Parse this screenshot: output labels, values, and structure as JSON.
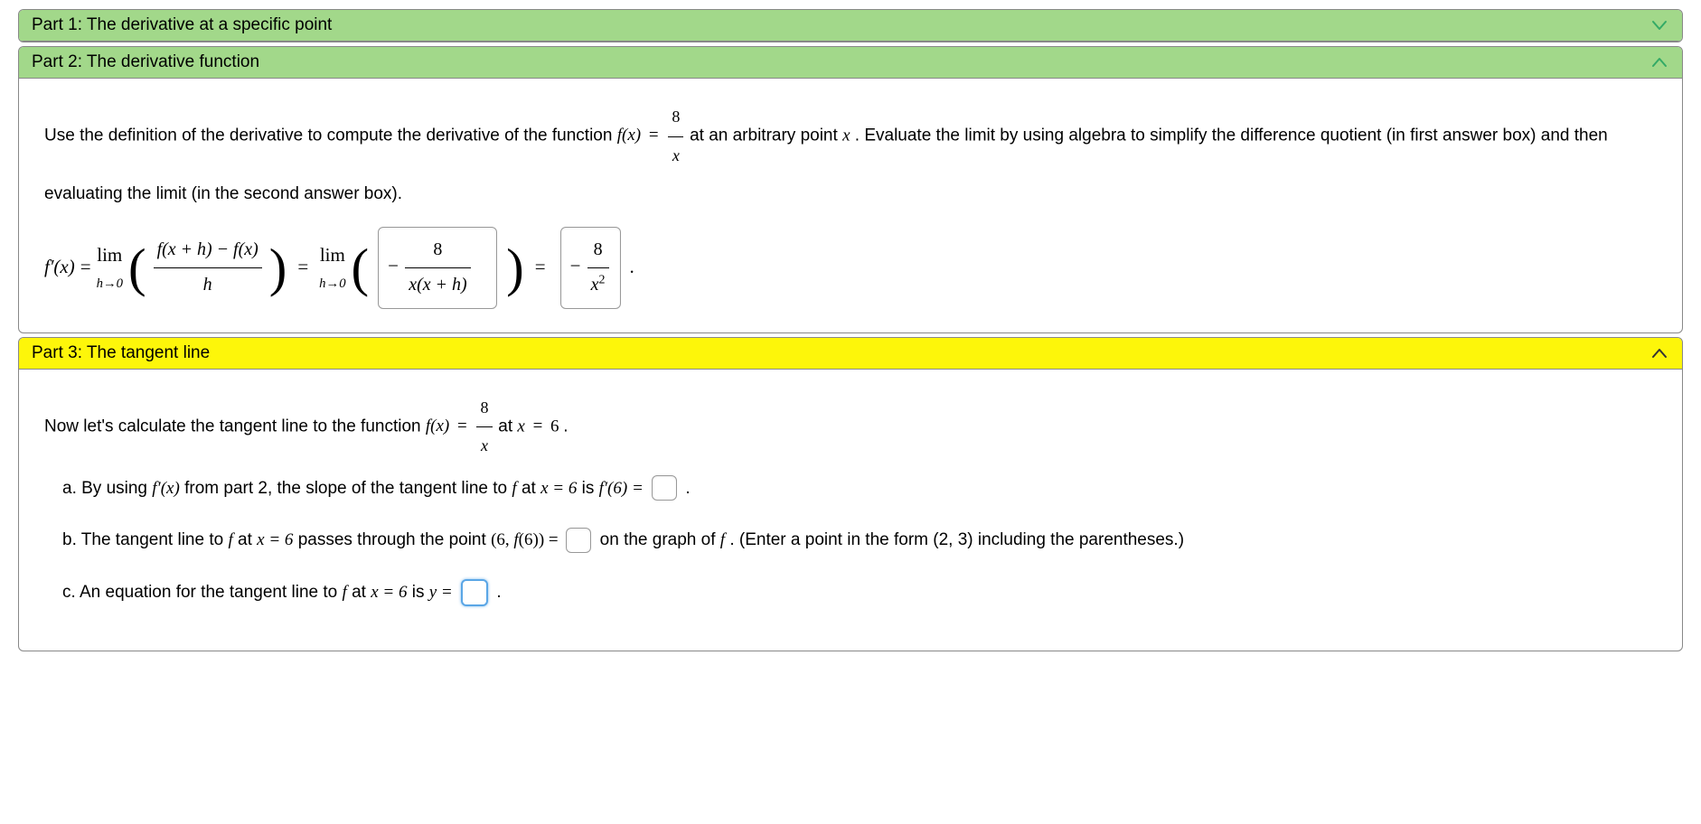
{
  "part1": {
    "title": "Part 1: The derivative at a specific point"
  },
  "part2": {
    "title": "Part 2: The derivative function",
    "intro_a": "Use the definition of the derivative to compute the derivative of the function ",
    "intro_b": " at an arbitrary point ",
    "intro_c": ". Evaluate the limit by using algebra to simplify the difference quotient (in first answer box) and then evaluating the limit (in the second answer box).",
    "func": {
      "lhs": "f(x)",
      "eq": "=",
      "num": "8",
      "den": "x"
    },
    "eq": {
      "lhs": "f′(x)",
      "eq": "=",
      "lim": "lim",
      "limsub": "h→0",
      "dq_num": "f(x + h) − f(x)",
      "dq_den": "h",
      "ans1_prefix": "−",
      "ans1_num": "8",
      "ans1_den": "x(x + h)",
      "ans2_prefix": "−",
      "ans2_num": "8",
      "ans2_den_base": "x",
      "ans2_den_exp": "2"
    }
  },
  "part3": {
    "title": "Part 3: The tangent line",
    "intro_a": "Now let's calculate the tangent line to the function ",
    "intro_b": " at ",
    "intro_c": ".",
    "func": {
      "lhs": "f(x)",
      "eq": "=",
      "num": "8",
      "den": "x"
    },
    "at": {
      "lhs": "x",
      "eq": "=",
      "val": "6"
    },
    "a": {
      "pre": "a. By using ",
      "fp": "f′(x)",
      "mid1": " from part 2, the slope of the tangent line to ",
      "f": "f",
      "mid2": " at ",
      "xeq": "x = 6",
      "mid3": " is ",
      "fp6": "f′(6) =",
      "period": "."
    },
    "b": {
      "pre": "b. The tangent line to ",
      "f": "f",
      "mid1": " at ",
      "xeq": "x = 6",
      "mid2": " passes through the point ",
      "point": "(6, f(6)) =",
      "mid3": " on the graph of ",
      "f2": "f",
      "post": ". (Enter a point in the form (2, 3) including the parentheses.)"
    },
    "c": {
      "pre": "c. An equation for the tangent line to ",
      "f": "f",
      "mid1": " at ",
      "xeq": "x = 6",
      "mid2": " is ",
      "yeq": "y =",
      "period": "."
    }
  }
}
